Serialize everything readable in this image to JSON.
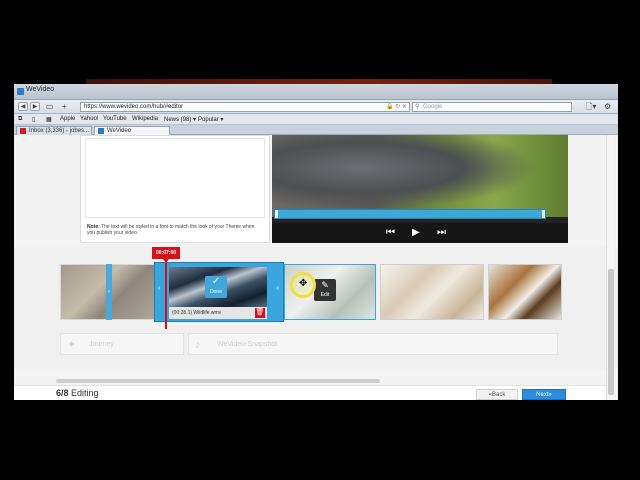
{
  "window": {
    "title": "WeVideo"
  },
  "toolbar": {
    "url": "https://www.wevideo.com/hub/#editor",
    "search_placeholder": "Google",
    "url_icons": "🔒 ↻ ✕"
  },
  "bookmarks": [
    "Apple",
    "Yahoo!",
    "YouTube",
    "Wikipedia",
    "News (98) ▾",
    "Popular ▾"
  ],
  "tabs": [
    {
      "label": "Inbox (3,336) - jobes..."
    },
    {
      "label": "WeVideo"
    }
  ],
  "editor": {
    "note_label": "Note:",
    "note_text": "The text will be styled in a font to match the look of your Theme when you publish your video."
  },
  "timeline": {
    "timecode": "00:07:00",
    "selected_clip_label": "(00:28.1) Wildlife.wmv",
    "done_label": "Done",
    "edit_label": "Edit",
    "fx": [
      {
        "icon": "wand-icon",
        "label": "Journey"
      },
      {
        "icon": "music-icon",
        "label": "WeVideo-Snapshot"
      }
    ]
  },
  "footer": {
    "step": "6/8",
    "step_label": "Editing",
    "back_label": "«Back",
    "next_label": "Next»"
  },
  "colors": {
    "accent": "#3ba6de",
    "playhead": "#d4101a",
    "next_button": "#2b8ce0"
  }
}
